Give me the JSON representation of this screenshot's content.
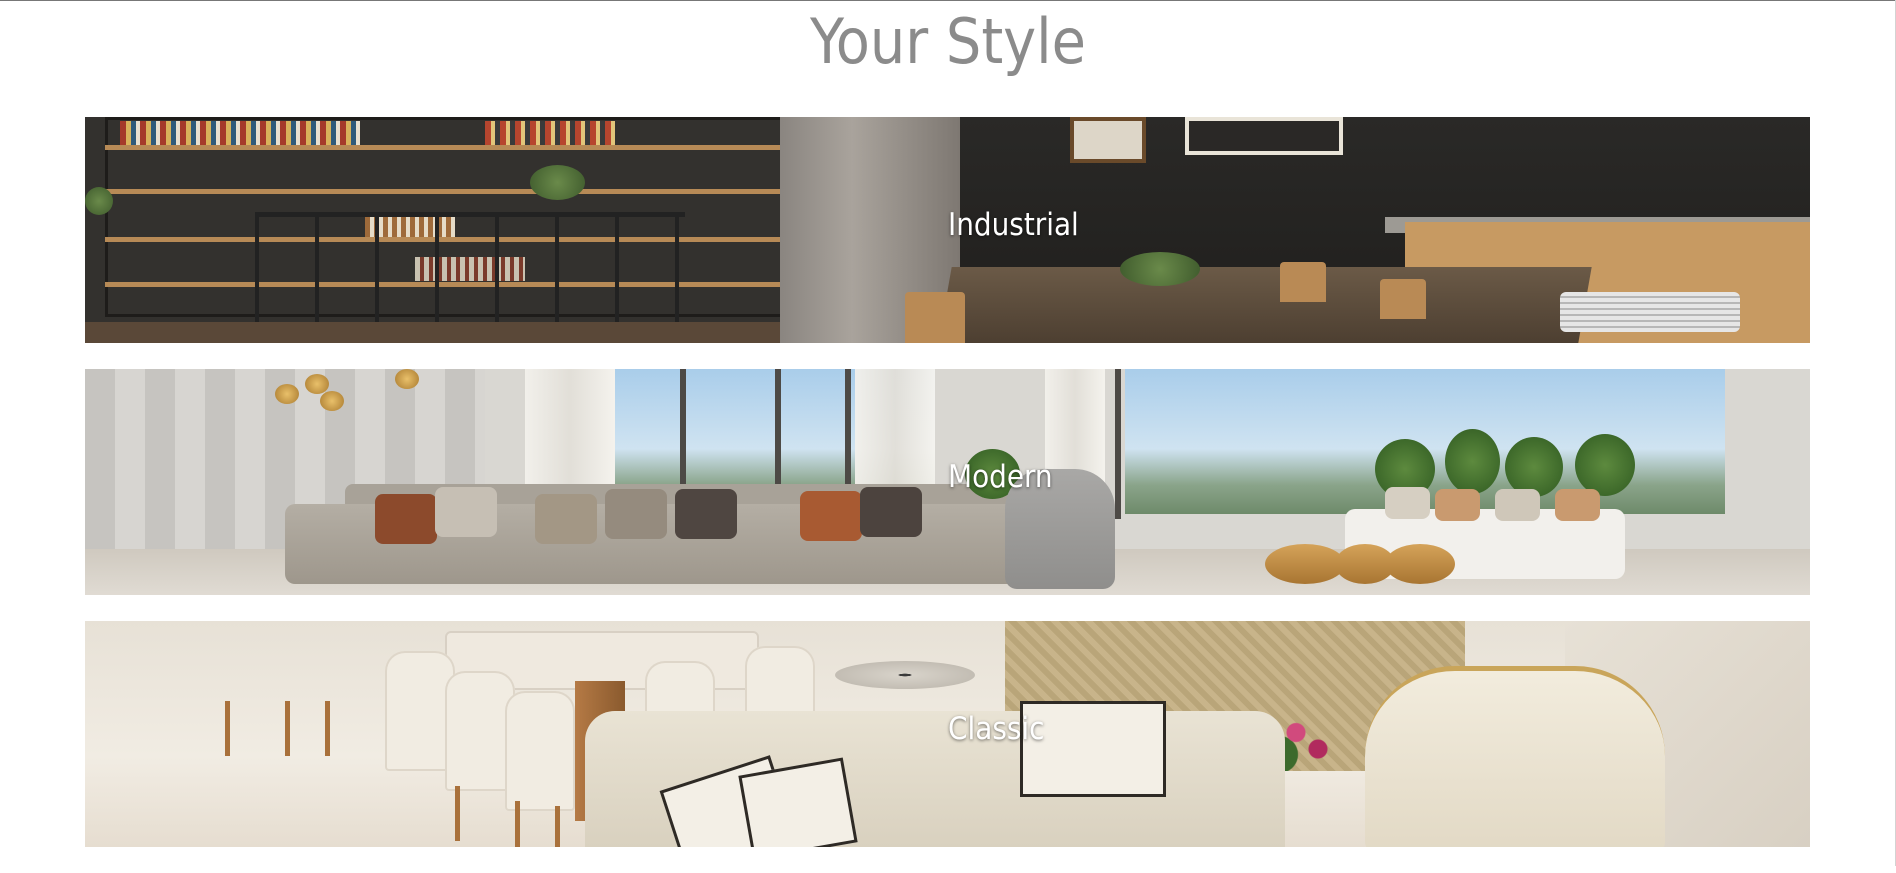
{
  "page": {
    "title": "Your Style"
  },
  "styles": [
    {
      "label": "Industrial",
      "name": "industrial"
    },
    {
      "label": "Modern",
      "name": "modern"
    },
    {
      "label": "Classic",
      "name": "classic"
    }
  ],
  "colors": {
    "title": "#8b8b8b",
    "label": "#ffffff",
    "background": "#ffffff"
  }
}
